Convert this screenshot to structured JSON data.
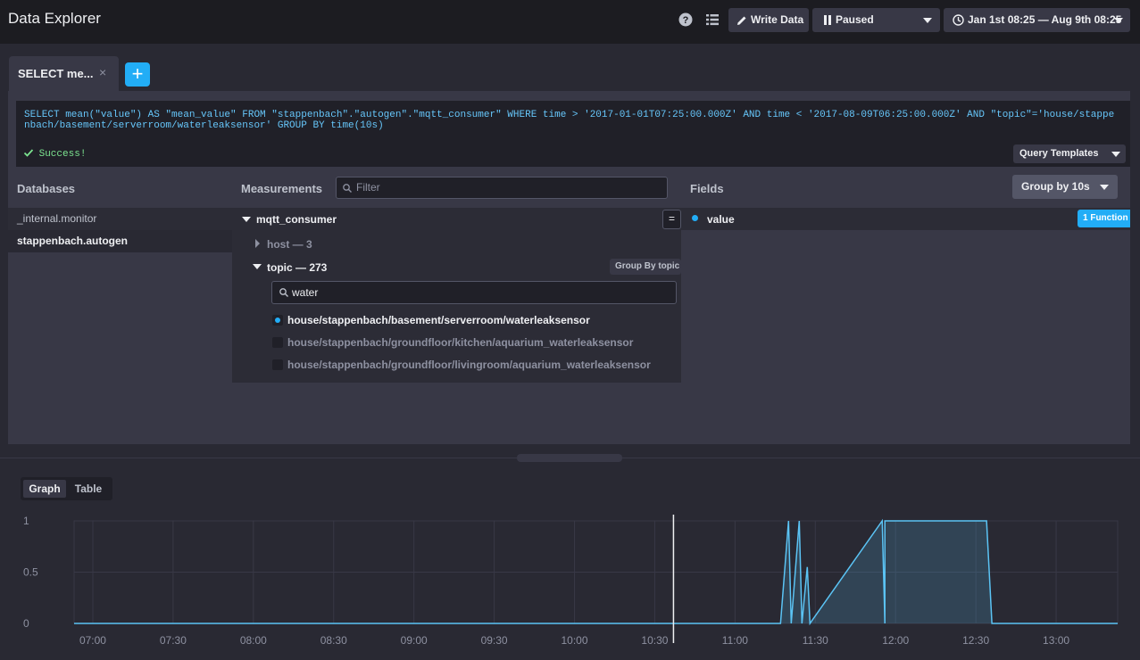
{
  "header": {
    "title": "Data Explorer",
    "write_data_label": "Write Data",
    "refresh_label": "Paused",
    "time_range_label": "Jan 1st 08:25 — Aug 9th 08:25"
  },
  "tabs": {
    "query_tab_label": "SELECT me...",
    "close_symbol": "×",
    "add_symbol": "+"
  },
  "editor": {
    "query": "SELECT mean(\"value\") AS \"mean_value\" FROM \"stappenbach\".\"autogen\".\"mqtt_consumer\" WHERE time > '2017-01-01T07:25:00.000Z' AND time < '2017-08-09T06:25:00.000Z' AND \"topic\"='house/stappenbach/basement/serverroom/waterleaksensor' GROUP BY time(10s)",
    "status": "Success!",
    "templates_label": "Query Templates"
  },
  "databases": {
    "heading": "Databases",
    "items": [
      "_internal.monitor",
      "stappenbach.autogen"
    ]
  },
  "measurements": {
    "heading": "Measurements",
    "filter_placeholder": "Filter",
    "measurement": "mqtt_consumer",
    "eq_symbol": "=",
    "tag_host": "host — 3",
    "tag_topic": "topic — 273",
    "group_by_tag_label": "Group By topic",
    "tag_search_value": "water",
    "tag_values": [
      "house/stappenbach/basement/serverroom/waterleaksensor",
      "house/stappenbach/groundfloor/kitchen/aquarium_waterleaksensor",
      "house/stappenbach/groundfloor/livingroom/aquarium_waterleaksensor"
    ]
  },
  "fields": {
    "heading": "Fields",
    "group_by_label": "Group by 10s",
    "field": "value",
    "function_badge": "1 Function"
  },
  "visualization": {
    "tab_graph": "Graph",
    "tab_table": "Table"
  },
  "colors": {
    "accent": "#22adf6",
    "series": "#5bc4f5",
    "success": "#7ce490"
  },
  "chart_data": {
    "type": "area",
    "title": "",
    "xlabel": "",
    "ylabel": "",
    "x_ticks": [
      "07:00",
      "07:30",
      "08:00",
      "08:30",
      "09:00",
      "09:30",
      "10:00",
      "10:30",
      "11:00",
      "11:30",
      "12:00",
      "12:30",
      "13:00"
    ],
    "y_ticks": [
      "0",
      "0.5",
      "1"
    ],
    "ylim": [
      0,
      1
    ],
    "xlim": [
      "06:53",
      "13:23"
    ],
    "grid": true,
    "series": [
      {
        "x": [
          "06:53",
          "11:17",
          "11:20",
          "11:21",
          "11:24",
          "11:25",
          "11:27",
          "11:28",
          "11:55",
          "11:56",
          "11:56",
          "11:57",
          "12:34",
          "12:36",
          "13:23"
        ],
        "values": [
          0,
          0,
          1,
          0,
          1,
          0,
          0.55,
          0,
          1,
          0,
          1,
          1,
          1,
          0,
          0
        ]
      }
    ],
    "crosshair_x": "10:37"
  }
}
